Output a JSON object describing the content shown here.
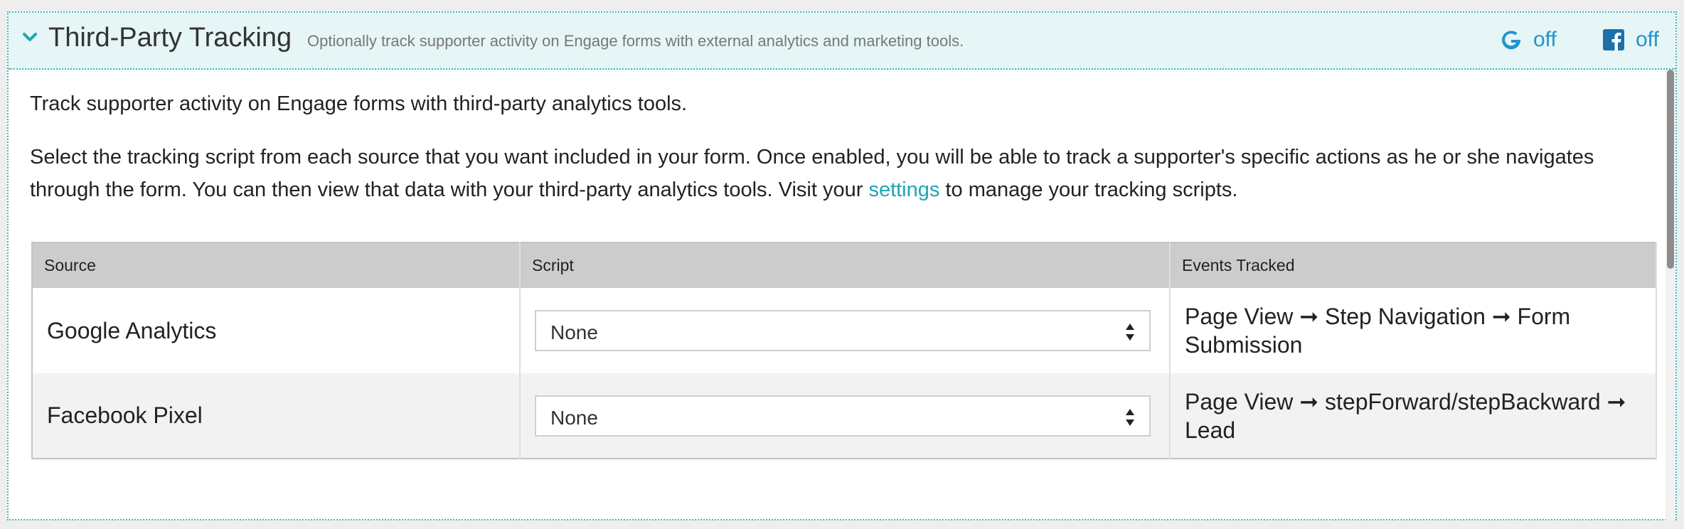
{
  "panel": {
    "title": "Third-Party Tracking",
    "subtitle": "Optionally track supporter activity on Engage forms with external analytics and marketing tools.",
    "status": {
      "google": {
        "icon": "google-icon",
        "label": "off"
      },
      "facebook": {
        "icon": "facebook-icon",
        "label": "off"
      }
    }
  },
  "body": {
    "intro": "Track supporter activity on Engage forms with third-party analytics tools.",
    "description_before_link": "Select the tracking script from each source that you want included in your form. Once enabled, you will be able to track a supporter's specific actions as he or she navigates through the form. You can then view that data with your third-party analytics tools. Visit your ",
    "settings_link": "settings",
    "description_after_link": " to manage your tracking scripts."
  },
  "table": {
    "headers": {
      "source": "Source",
      "script": "Script",
      "events": "Events Tracked"
    },
    "rows": [
      {
        "source": "Google Analytics",
        "script_value": "None",
        "events": "Page View ➞ Step Navigation ➞ Form Submission"
      },
      {
        "source": "Facebook Pixel",
        "script_value": "None",
        "events": "Page View ➞ stepForward/stepBackward ➞ Lead"
      }
    ]
  },
  "colors": {
    "accent": "#1fa5b3",
    "status_blue": "#1f95cc",
    "header_bg": "#e6f5f5",
    "table_header_bg": "#cccccc"
  }
}
